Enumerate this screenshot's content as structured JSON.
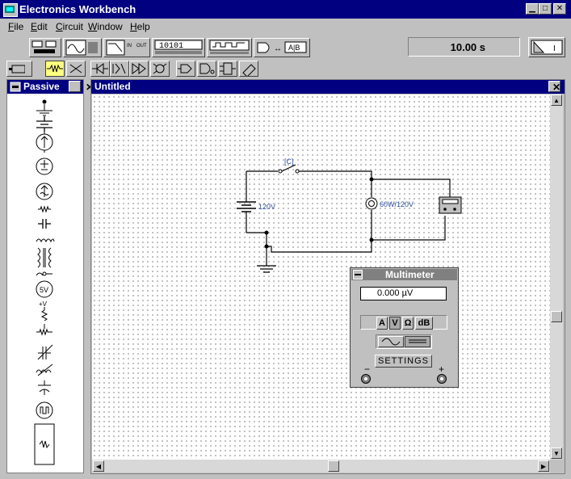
{
  "app": {
    "title": "Electronics Workbench"
  },
  "menu": [
    "File",
    "Edit",
    "Circuit",
    "Window",
    "Help"
  ],
  "menu_underline": [
    "F",
    "E",
    "C",
    "W",
    "H"
  ],
  "menu_rest": [
    "ile",
    "dit",
    "ircuit",
    "indow",
    "elp"
  ],
  "toolbar": {
    "timer": "10.00 s",
    "instrument_labels": {
      "ab": "A|B",
      "digits": "10101",
      "in": "IN",
      "out": "OUT"
    }
  },
  "palette": {
    "title": "Passive"
  },
  "circuit_window": {
    "title": "Untitled"
  },
  "circuit": {
    "switch_label": "[C]",
    "battery_label": "120V",
    "lamp_label": "60W/120V"
  },
  "multimeter": {
    "title": "Multimeter",
    "reading": "0.000 µV",
    "modes": [
      "A",
      "V",
      "Ω",
      "dB"
    ],
    "selected_mode": "V",
    "settings_label": "SETTINGS",
    "minus_label": "−",
    "plus_label": "+"
  }
}
